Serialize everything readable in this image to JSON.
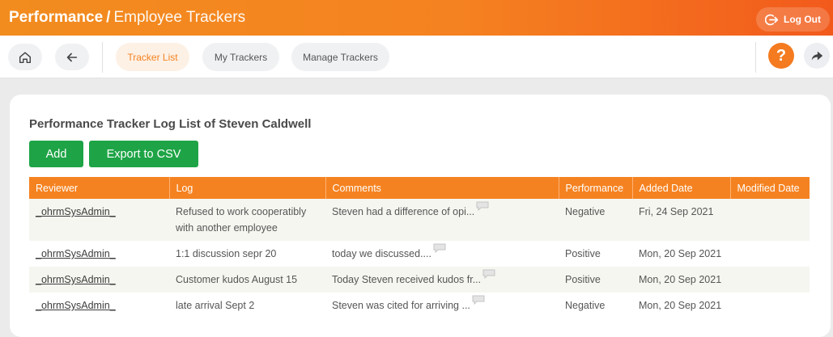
{
  "header": {
    "module": "Performance",
    "separator": "/",
    "page": "Employee Trackers",
    "logout_label": "Log Out"
  },
  "nav": {
    "tabs": [
      {
        "label": "Tracker List",
        "active": true
      },
      {
        "label": "My Trackers",
        "active": false
      },
      {
        "label": "Manage Trackers",
        "active": false
      }
    ],
    "help_label": "?"
  },
  "main": {
    "title": "Performance Tracker Log List of Steven Caldwell",
    "add_label": "Add",
    "export_label": "Export to CSV",
    "columns": [
      "Reviewer",
      "Log",
      "Comments",
      "Performance",
      "Added Date",
      "Modified Date"
    ],
    "rows": [
      {
        "reviewer": "_ohrmSysAdmin_",
        "log": "Refused to work cooperatibly with another employee",
        "comments": "Steven had a difference of opi...",
        "performance": "Negative",
        "added": "Fri, 24 Sep 2021",
        "modified": ""
      },
      {
        "reviewer": "_ohrmSysAdmin_",
        "log": "1:1 discussion sepr 20",
        "comments": "today we discussed....",
        "performance": "Positive",
        "added": "Mon, 20 Sep 2021",
        "modified": ""
      },
      {
        "reviewer": "_ohrmSysAdmin_",
        "log": "Customer kudos August 15",
        "comments": "Today Steven received kudos fr...",
        "performance": "Positive",
        "added": "Mon, 20 Sep 2021",
        "modified": ""
      },
      {
        "reviewer": "_ohrmSysAdmin_",
        "log": "late arrival Sept 2",
        "comments": "Steven was cited for arriving ...",
        "performance": "Negative",
        "added": "Mon, 20 Sep 2021",
        "modified": ""
      }
    ]
  },
  "colors": {
    "accent": "#f58220",
    "button_green": "#1ea446",
    "row_tint": "#f6f6f1"
  },
  "icons": [
    "logout-icon",
    "home-icon",
    "back-arrow-icon",
    "help-icon",
    "share-icon",
    "comment-icon"
  ]
}
